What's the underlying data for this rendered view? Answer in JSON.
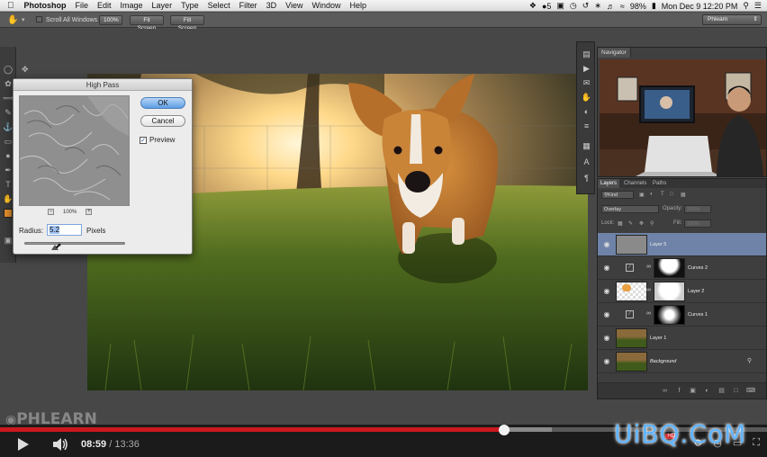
{
  "menubar": {
    "app_name": "Photoshop",
    "items": [
      "File",
      "Edit",
      "Image",
      "Layer",
      "Type",
      "Select",
      "Filter",
      "3D",
      "View",
      "Window",
      "Help"
    ],
    "status_badge": "5",
    "battery": "98%",
    "clock": "Mon Dec 9  12:20 PM"
  },
  "optionsbar": {
    "scroll_all_windows": "Scroll All Windows",
    "zoom_100": "100%",
    "fit_screen": "Fit Screen",
    "fill_screen": "Fill Screen",
    "workspace": "Phlearn"
  },
  "dialog": {
    "title": "High Pass",
    "ok": "OK",
    "cancel": "Cancel",
    "preview_label": "Preview",
    "preview_checked": true,
    "zoom_level": "100%",
    "radius_label": "Radius:",
    "radius_value": "5.2",
    "units": "Pixels",
    "slider_position": 0.3
  },
  "navigator": {
    "tab": "Navigator"
  },
  "layers_panel": {
    "tabs": [
      "Layers",
      "Channels",
      "Paths"
    ],
    "kind_filter": "Kind",
    "blend_mode": "Overlay",
    "opacity_label": "Opacity:",
    "opacity_value": "100%",
    "lock_label": "Lock:",
    "fill_label": "Fill:",
    "fill_value": "100%",
    "layers": [
      {
        "name": "Layer 5",
        "selected": true
      },
      {
        "name": "Curves 2",
        "selected": false
      },
      {
        "name": "Layer 2",
        "selected": false
      },
      {
        "name": "Curves 1",
        "selected": false
      },
      {
        "name": "Layer 1",
        "selected": false
      },
      {
        "name": "Background",
        "selected": false,
        "italic": true
      }
    ]
  },
  "watermark": "PHLEARN",
  "player": {
    "current_time": "08:59",
    "separator": "/",
    "duration": "13:36",
    "played_fraction": 0.657,
    "buffered_fraction": 0.72,
    "hd_label": "HD"
  },
  "site_watermark": "UiBQ.CoM",
  "colors": {
    "accent_red": "#cc181e",
    "layer_selected": "#6f83a8",
    "foreground_swatch": "#e08c2d"
  }
}
